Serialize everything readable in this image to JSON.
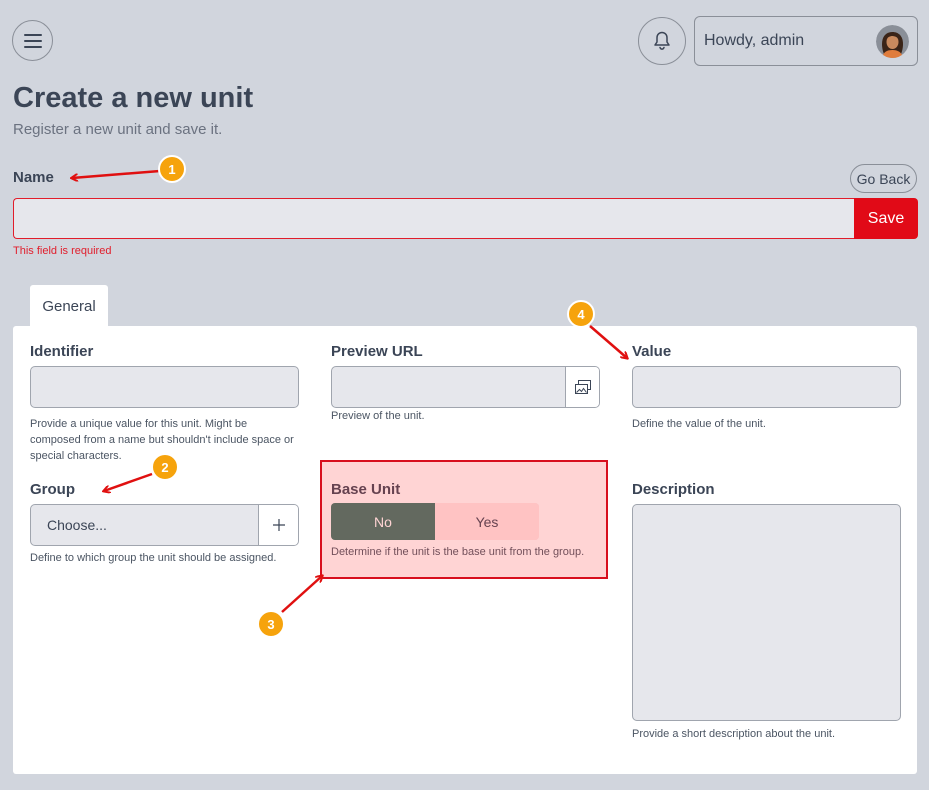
{
  "header": {
    "greeting": "Howdy, admin"
  },
  "page": {
    "title": "Create a new unit",
    "subtitle": "Register a new unit and save it."
  },
  "name_field": {
    "label": "Name",
    "value": "",
    "error": "This field is required",
    "go_back_label": "Go Back",
    "save_label": "Save"
  },
  "tabs": [
    {
      "label": "General",
      "active": true
    }
  ],
  "form": {
    "identifier": {
      "label": "Identifier",
      "help": "Provide a unique value for this unit. Might be composed from a name but shouldn't include space or special characters."
    },
    "preview_url": {
      "label": "Preview URL",
      "help": "Preview of the unit."
    },
    "value": {
      "label": "Value",
      "help": "Define the value of the unit."
    },
    "group": {
      "label": "Group",
      "placeholder": "Choose...",
      "help": "Define to which group the unit should be assigned."
    },
    "base_unit": {
      "label": "Base Unit",
      "options": [
        "No",
        "Yes"
      ],
      "selected": "No",
      "help": "Determine if the unit is the base unit from the group."
    },
    "description": {
      "label": "Description",
      "help": "Provide a short description about the unit."
    }
  },
  "annotations": {
    "badges": [
      "1",
      "2",
      "3",
      "4"
    ]
  },
  "colors": {
    "background": "#d1d5dd",
    "accent_green": "#38766a",
    "error_red": "#e10a17",
    "badge_orange": "#f6a30c"
  }
}
